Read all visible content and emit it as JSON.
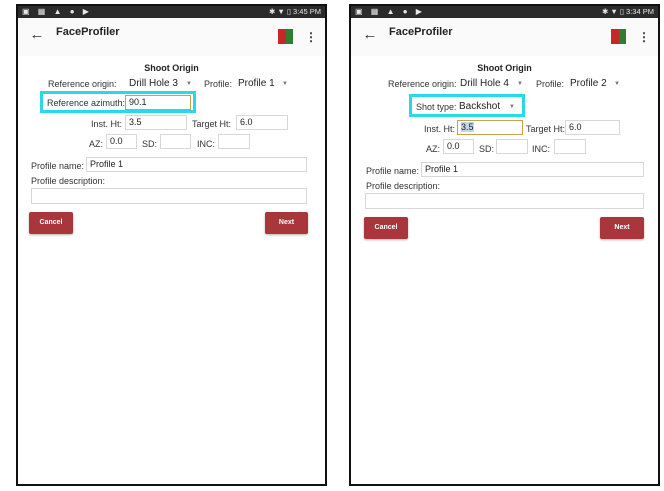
{
  "screens": [
    {
      "status": {
        "left_icons": "▣ ▦ ▲ ● ▶",
        "right": "✱ ▼ ▯ 3:45 PM"
      },
      "app_title": "FaceProfiler",
      "screen_title": "Shoot Origin",
      "ref_origin_label": "Reference origin:",
      "ref_origin_value": "Drill Hole 3",
      "profile_label": "Profile:",
      "profile_value": "Profile 1",
      "highlight_label": "Reference azimuth:",
      "highlight_value_selected": "",
      "highlight_value": "90.1",
      "inst_ht_label": "Inst. Ht:",
      "inst_ht_value": "3.5",
      "target_ht_label": "Target Ht:",
      "target_ht_value": "6.0",
      "az_label": "AZ:",
      "az_value": "0.0",
      "sd_label": "SD:",
      "sd_value": "",
      "inc_label": "INC:",
      "inc_value": "",
      "profile_name_label": "Profile name:",
      "profile_name_value": "Profile 1",
      "profile_description_label": "Profile description:",
      "profile_description_value": "",
      "cancel_label": "Cancel",
      "next_label": "Next"
    },
    {
      "status": {
        "left_icons": "▣ ▦ ▲ ● ▶",
        "right": "✱ ▼ ▯ 3:34 PM"
      },
      "app_title": "FaceProfiler",
      "screen_title": "Shoot Origin",
      "ref_origin_label": "Reference origin:",
      "ref_origin_value": "Drill Hole 4",
      "profile_label": "Profile:",
      "profile_value": "Profile 2",
      "highlight_label": "Shot type:",
      "highlight_value": "Backshot",
      "inst_ht_label": "Inst. Ht:",
      "inst_ht_value": "3.5",
      "target_ht_label": "Target Ht:",
      "target_ht_value": "6.0",
      "az_label": "AZ:",
      "az_value": "0.0",
      "sd_label": "SD:",
      "sd_value": "",
      "inc_label": "INC:",
      "inc_value": "",
      "profile_name_label": "Profile name:",
      "profile_name_value": "Profile 1",
      "profile_description_label": "Profile description:",
      "profile_description_value": "",
      "cancel_label": "Cancel",
      "next_label": "Next"
    }
  ],
  "icons": {
    "back": "arrow-left",
    "menu": "more-vertical",
    "logo": "faceprofiler-logo",
    "dropdown": "caret-down"
  },
  "colors": {
    "highlight": "#29d9e6",
    "button": "#a8363a",
    "status_bar": "#2b2b2b",
    "focus_border": "#c9a14a",
    "text_selection": "#bcd6ea"
  }
}
